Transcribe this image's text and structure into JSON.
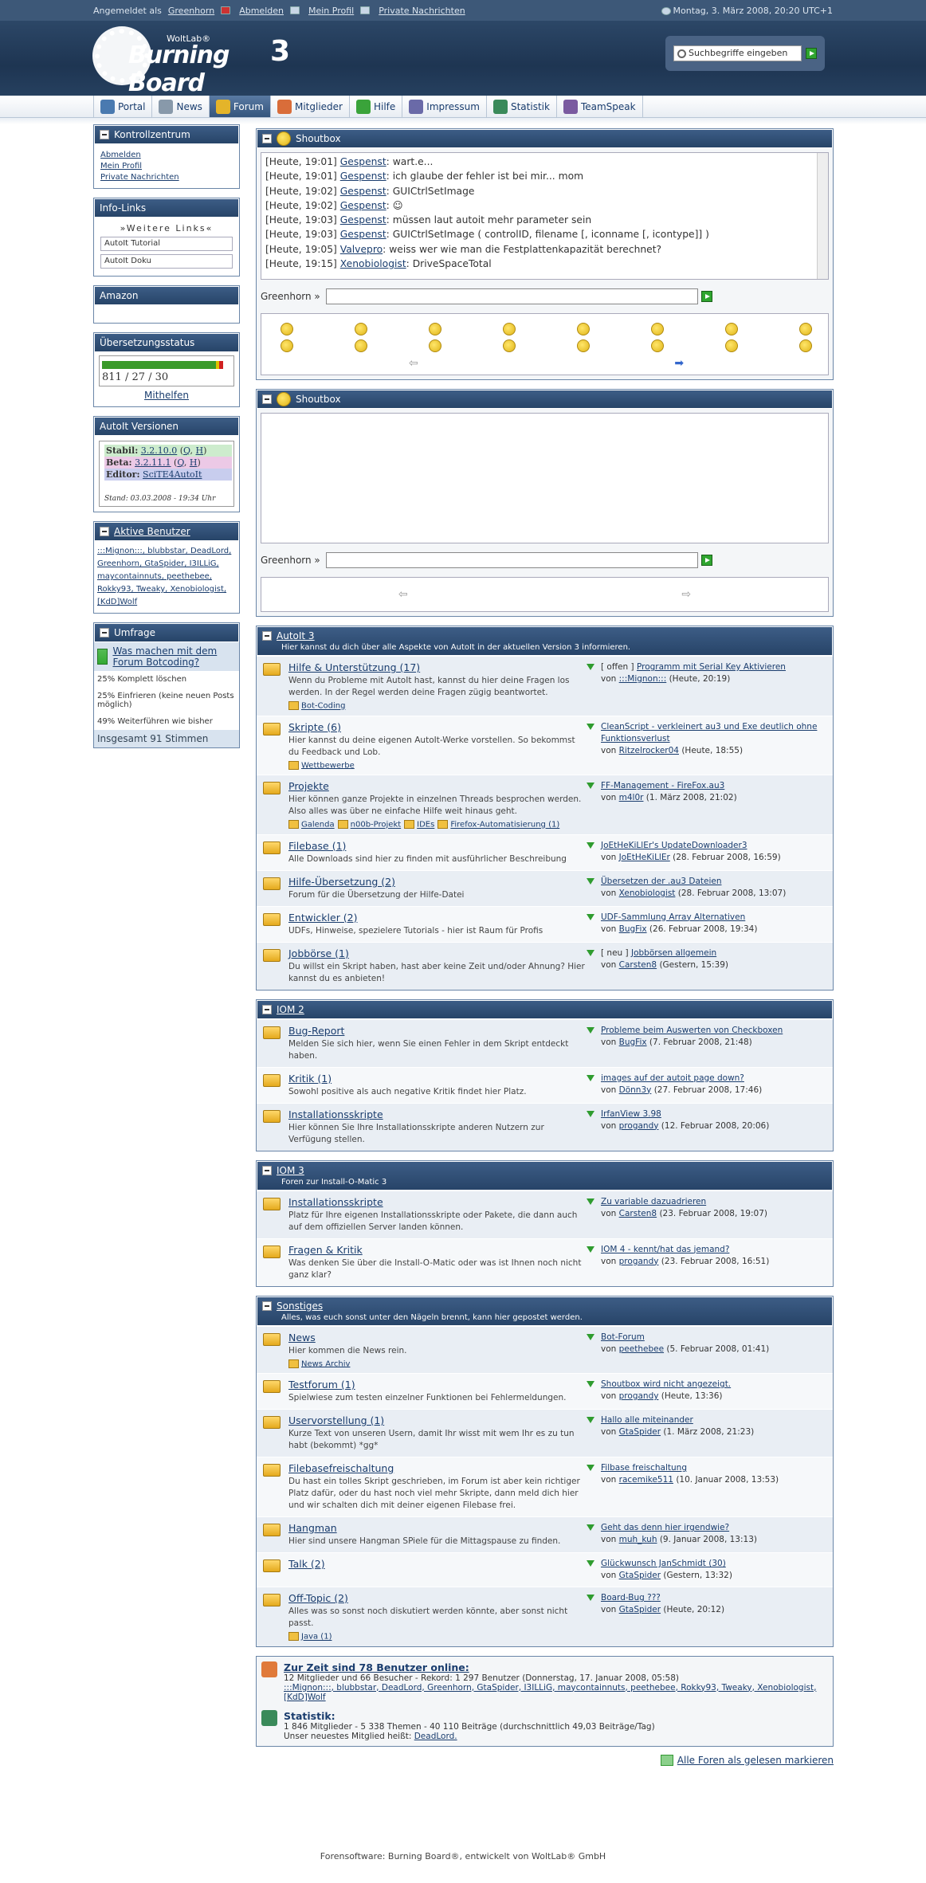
{
  "topbar": {
    "logged_in_prefix": "Angemeldet als",
    "user": "Greenhorn",
    "logout": "Abmelden",
    "profile": "Mein Profil",
    "messages": "Private Nachrichten",
    "date": "Montag, 3. März 2008, 20:20 UTC+1"
  },
  "header": {
    "logo_woltlab": "WoltLab®",
    "logo_text": "Burning Board",
    "logo_version": "3",
    "search_placeholder": "Suchbegriffe eingeben"
  },
  "nav": [
    {
      "label": "Portal",
      "icon": "portal-icon",
      "color": "#4a7ab0"
    },
    {
      "label": "News",
      "icon": "news-icon",
      "color": "#8899aa"
    },
    {
      "label": "Forum",
      "icon": "forum-icon",
      "color": "#e4b42a"
    },
    {
      "label": "Mitglieder",
      "icon": "members-icon",
      "color": "#d96d3a"
    },
    {
      "label": "Hilfe",
      "icon": "help-icon",
      "color": "#3aa33a"
    },
    {
      "label": "Impressum",
      "icon": "impressum-icon",
      "color": "#6a6aa8"
    },
    {
      "label": "Statistik",
      "icon": "statistics-icon",
      "color": "#3a8a5a"
    },
    {
      "label": "TeamSpeak",
      "icon": "teamspeak-icon",
      "color": "#7a5aa0"
    }
  ],
  "sidebar": {
    "kontroll": {
      "title": "Kontrollzentrum",
      "links": [
        "Abmelden",
        "Mein Profil",
        "Private Nachrichten"
      ]
    },
    "infolinks": {
      "title": "Info-Links",
      "weitere": "»Weitere Links«",
      "items": [
        "AutoIt Tutorial",
        "AutoIt Doku"
      ]
    },
    "amazon": {
      "title": "Amazon"
    },
    "uebersetzung": {
      "title": "Übersetzungsstatus",
      "nums": "811 / 27 / 30",
      "help": "Mithelfen"
    },
    "versionen": {
      "title": "AutoIt Versionen",
      "stabil_label": "Stabil:",
      "stabil": "3.2.10.0",
      "beta_label": "Beta:",
      "beta": "3.2.11.1",
      "editor_label": "Editor:",
      "editor": "SciTE4AutoIt",
      "q": "Q",
      "h": "H",
      "stand": "Stand: 03.03.2008 - 19:34 Uhr"
    },
    "aktive": {
      "title": "Aktive Benutzer",
      "users": ":::Mignon:::, blubbstar, DeadLord, Greenhorn, GtaSpider, I3ILLiG, maycontainnuts, peethebee, Rokky93, Tweaky, Xenobiologist, [KdD]Wolf"
    },
    "umfrage": {
      "title": "Umfrage",
      "question": "Was machen mit dem Forum Botcoding?",
      "r1": "25%  Komplett löschen",
      "r2": "25%  Einfrieren (keine neuen Posts möglich)",
      "r3": "49%  Weiterführen wie bisher",
      "total": "Insgesamt 91 Stimmen"
    }
  },
  "shoutbox": {
    "title": "Shoutbox",
    "lines": [
      {
        "time": "[Heute, 19:01]",
        "name": "Gespenst",
        "text": ": wart.e..."
      },
      {
        "time": "[Heute, 19:01]",
        "name": "Gespenst",
        "text": ": ich glaube der fehler ist bei mir... mom"
      },
      {
        "time": "[Heute, 19:02]",
        "name": "Gespenst",
        "text": ": GUICtrlSetImage"
      },
      {
        "time": "[Heute, 19:02]",
        "name": "Gespenst",
        "text": ": ☺"
      },
      {
        "time": "[Heute, 19:03]",
        "name": "Gespenst",
        "text": ": müssen laut autoit mehr parameter sein"
      },
      {
        "time": "[Heute, 19:03]",
        "name": "Gespenst",
        "text": ": GUICtrlSetImage ( controlID, filename [, iconname [, icontype]] )"
      },
      {
        "time": "[Heute, 19:05]",
        "name": "Valvepro",
        "text": ": weiss wer wie man die Festplattenkapazität berechnet?"
      },
      {
        "time": "[Heute, 19:15]",
        "name": "Xenobiologist",
        "text": ": DriveSpaceTotal"
      }
    ],
    "user_label": "Greenhorn »"
  },
  "shoutbox2": {
    "title": "Shoutbox",
    "user_label": "Greenhorn »"
  },
  "categories": [
    {
      "title": "AutoIt 3",
      "desc": "Hier kannst du dich über alle Aspekte von AutoIt in der aktuellen Version 3 informieren.",
      "forums": [
        {
          "name": "Hilfe & Unterstützung (17)",
          "desc": "Wenn du Probleme mit AutoIt hast, kannst du hier deine Fragen los werden. In der Regel werden deine Fragen zügig beantwortet.",
          "subs": [
            "Bot-Coding"
          ],
          "prefix": "[ offen ] ",
          "last": "Programm mit Serial Key Aktivieren",
          "by": ":::Mignon:::",
          "when": " (Heute, 20:19)"
        },
        {
          "name": "Skripte (6)",
          "desc": "Hier kannst du deine eigenen AutoIt-Werke vorstellen. So bekommst du Feedback und Lob.",
          "subs": [
            "Wettbewerbe"
          ],
          "prefix": "",
          "last": "CleanScript - verkleinert au3 und Exe deutlich ohne Funktionsverlust",
          "by": "Ritzelrocker04",
          "when": " (Heute, 18:55)"
        },
        {
          "name": "Projekte",
          "desc": "Hier können ganze Projekte in einzelnen Threads besprochen werden. Also alles was über ne einfache Hilfe weit hinaus geht.",
          "subs": [
            "Galenda",
            "n00b-Projekt",
            "IDEs",
            "Firefox-Automatisierung (1)"
          ],
          "prefix": "",
          "last": "FF-Management - FireFox.au3",
          "by": "m4l0r",
          "when": " (1. März 2008, 21:02)"
        },
        {
          "name": "Filebase (1)",
          "desc": "Alle Downloads sind hier zu finden mit ausführlicher Beschreibung",
          "subs": [],
          "prefix": "",
          "last": "JoEtHeKiLlEr's UpdateDownloader3",
          "by": "JoEtHeKiLlEr",
          "when": " (28. Februar 2008, 16:59)"
        },
        {
          "name": "Hilfe-Übersetzung (2)",
          "desc": "Forum für die Übersetzung der Hilfe-Datei",
          "subs": [],
          "prefix": "",
          "last": "Übersetzen der .au3 Dateien",
          "by": "Xenobiologist",
          "when": " (28. Februar 2008, 13:07)"
        },
        {
          "name": "Entwickler (2)",
          "desc": "UDFs, Hinweise, spezielere Tutorials - hier ist Raum für Profis",
          "subs": [],
          "prefix": "",
          "last": "UDF-Sammlung Array Alternativen",
          "by": "BugFix",
          "when": " (26. Februar 2008, 19:34)"
        },
        {
          "name": "Jobbörse (1)",
          "desc": "Du willst ein Skript haben, hast aber keine Zeit und/oder Ahnung? Hier kannst du es anbieten!",
          "subs": [],
          "prefix": "[ neu ] ",
          "last": "Jobbörsen allgemein",
          "by": "Carsten8",
          "when": " (Gestern, 15:39)"
        }
      ]
    },
    {
      "title": "IOM 2",
      "desc": "",
      "forums": [
        {
          "name": "Bug-Report",
          "desc": "Melden Sie sich hier, wenn Sie einen Fehler in dem Skript entdeckt haben.",
          "subs": [],
          "prefix": "",
          "last": "Probleme beim Auswerten von Checkboxen",
          "by": "BugFix",
          "when": " (7. Februar 2008, 21:48)"
        },
        {
          "name": "Kritik (1)",
          "desc": "Sowohl positive als auch negative Kritik findet hier Platz.",
          "subs": [],
          "prefix": "",
          "last": "images auf der autoit page down?",
          "by": "Dönn3y",
          "when": " (27. Februar 2008, 17:46)"
        },
        {
          "name": "Installationsskripte",
          "desc": "Hier können Sie Ihre Installationsskripte anderen Nutzern zur Verfügung stellen.",
          "subs": [],
          "prefix": "",
          "last": "IrfanView 3.98",
          "by": "progandy",
          "when": " (12. Februar 2008, 20:06)"
        }
      ]
    },
    {
      "title": "IOM 3",
      "desc": "Foren zur Install-O-Matic 3",
      "forums": [
        {
          "name": "Installationsskripte",
          "desc": "Platz für Ihre eigenen Installationsskripte oder Pakete, die dann auch auf dem offiziellen Server landen können.",
          "subs": [],
          "prefix": "",
          "last": "Zu variable dazuadrieren",
          "by": "Carsten8",
          "when": " (23. Februar 2008, 19:07)"
        },
        {
          "name": "Fragen & Kritik",
          "desc": "Was denken Sie über die Install-O-Matic oder was ist Ihnen noch nicht ganz klar?",
          "subs": [],
          "prefix": "",
          "last": "IOM 4 - kennt/hat das jemand?",
          "by": "progandy",
          "when": " (23. Februar 2008, 16:51)"
        }
      ]
    },
    {
      "title": "Sonstiges",
      "desc": "Alles, was euch sonst unter den Nägeln brennt, kann hier gepostet werden.",
      "forums": [
        {
          "name": "News",
          "desc": "Hier kommen die News rein.",
          "subs": [
            "News Archiv"
          ],
          "prefix": "",
          "last": "Bot-Forum",
          "by": "peethebee",
          "when": " (5. Februar 2008, 01:41)"
        },
        {
          "name": "Testforum (1)",
          "desc": "Spielwiese zum testen einzelner Funktionen bei Fehlermeldungen.",
          "subs": [],
          "prefix": "",
          "last": "Shoutbox wird nicht angezeigt.",
          "by": "progandy",
          "when": " (Heute, 13:36)"
        },
        {
          "name": "Uservorstellung (1)",
          "desc": "Kurze Text von unseren Usern, damit Ihr wisst mit wem Ihr es zu tun habt (bekommt) *gg*",
          "subs": [],
          "prefix": "",
          "last": "Hallo alle miteinander",
          "by": "GtaSpider",
          "when": " (1. März 2008, 21:23)"
        },
        {
          "name": "Filebasefreischaltung",
          "desc": "Du hast ein tolles Skript geschrieben, im Forum ist aber kein richtiger Platz dafür, oder du hast noch viel mehr Skripte, dann meld dich hier und wir schalten dich mit deiner eigenen Filebase frei.",
          "subs": [],
          "prefix": "",
          "last": "Filbase freischaltung",
          "by": "racemike511",
          "when": " (10. Januar 2008, 13:53)"
        },
        {
          "name": "Hangman",
          "desc": "Hier sind unsere Hangman SPiele für die Mittagspause zu finden.",
          "subs": [],
          "prefix": "",
          "last": "Geht das denn hier irgendwie?",
          "by": "muh_kuh",
          "when": " (9. Januar 2008, 13:13)"
        },
        {
          "name": "Talk (2)",
          "desc": "",
          "subs": [],
          "prefix": "",
          "last": "Glückwunsch JanSchmidt (30)",
          "by": "GtaSpider",
          "when": " (Gestern, 13:32)"
        },
        {
          "name": "Off-Topic (2)",
          "desc": "Alles was so sonst noch diskutiert werden könnte, aber sonst nicht passt.",
          "subs": [
            "Java (1)"
          ],
          "prefix": "",
          "last": "Board-Bug ???",
          "by": "GtaSpider",
          "when": " (Heute, 20:12)"
        }
      ]
    }
  ],
  "online": {
    "title": "Zur Zeit sind 78 Benutzer online:",
    "line1": "12 Mitglieder und 66 Besucher - Rekord: 1 297 Benutzer (Donnerstag, 17. Januar 2008, 05:58)",
    "users": ":::Mignon:::, blubbstar, DeadLord, Greenhorn, GtaSpider, I3ILLiG, maycontainnuts, peethebee, Rokky93, Tweaky, Xenobiologist, [KdD]Wolf"
  },
  "statistik": {
    "title": "Statistik:",
    "line1": "1 846 Mitglieder - 5 338 Themen - 40 110 Beiträge (durchschnittlich 49,03 Beiträge/Tag)",
    "newest_prefix": "Unser neuestes Mitglied heißt: ",
    "newest": "DeadLord."
  },
  "markall": "Alle Foren als gelesen markieren",
  "footer": "Forensoftware: Burning Board®, entwickelt von WoltLab® GmbH",
  "von": "von "
}
